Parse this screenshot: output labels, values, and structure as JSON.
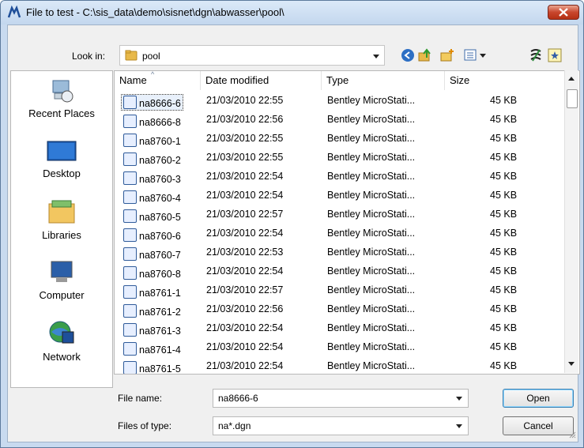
{
  "title": "File to test - C:\\sis_data\\demo\\sisnet\\dgn\\abwasser\\pool\\",
  "look_in": {
    "label": "Look in:",
    "value": "pool"
  },
  "toolbar_icons": [
    "back-icon",
    "up-folder-icon",
    "new-folder-icon",
    "view-menu-icon",
    "app-icon",
    "favorite-icon"
  ],
  "places": [
    {
      "label": "Recent Places",
      "icon": "recent-places-icon"
    },
    {
      "label": "Desktop",
      "icon": "desktop-icon"
    },
    {
      "label": "Libraries",
      "icon": "libraries-icon"
    },
    {
      "label": "Computer",
      "icon": "computer-icon"
    },
    {
      "label": "Network",
      "icon": "network-icon"
    }
  ],
  "columns": [
    "Name",
    "Date modified",
    "Type",
    "Size"
  ],
  "files": [
    {
      "name": "na8666-6",
      "date": "21/03/2010 22:55",
      "type": "Bentley MicroStati...",
      "size": "45 KB"
    },
    {
      "name": "na8666-8",
      "date": "21/03/2010 22:56",
      "type": "Bentley MicroStati...",
      "size": "45 KB"
    },
    {
      "name": "na8760-1",
      "date": "21/03/2010 22:55",
      "type": "Bentley MicroStati...",
      "size": "45 KB"
    },
    {
      "name": "na8760-2",
      "date": "21/03/2010 22:55",
      "type": "Bentley MicroStati...",
      "size": "45 KB"
    },
    {
      "name": "na8760-3",
      "date": "21/03/2010 22:54",
      "type": "Bentley MicroStati...",
      "size": "45 KB"
    },
    {
      "name": "na8760-4",
      "date": "21/03/2010 22:54",
      "type": "Bentley MicroStati...",
      "size": "45 KB"
    },
    {
      "name": "na8760-5",
      "date": "21/03/2010 22:57",
      "type": "Bentley MicroStati...",
      "size": "45 KB"
    },
    {
      "name": "na8760-6",
      "date": "21/03/2010 22:54",
      "type": "Bentley MicroStati...",
      "size": "45 KB"
    },
    {
      "name": "na8760-7",
      "date": "21/03/2010 22:53",
      "type": "Bentley MicroStati...",
      "size": "45 KB"
    },
    {
      "name": "na8760-8",
      "date": "21/03/2010 22:54",
      "type": "Bentley MicroStati...",
      "size": "45 KB"
    },
    {
      "name": "na8761-1",
      "date": "21/03/2010 22:57",
      "type": "Bentley MicroStati...",
      "size": "45 KB"
    },
    {
      "name": "na8761-2",
      "date": "21/03/2010 22:56",
      "type": "Bentley MicroStati...",
      "size": "45 KB"
    },
    {
      "name": "na8761-3",
      "date": "21/03/2010 22:54",
      "type": "Bentley MicroStati...",
      "size": "45 KB"
    },
    {
      "name": "na8761-4",
      "date": "21/03/2010 22:54",
      "type": "Bentley MicroStati...",
      "size": "45 KB"
    },
    {
      "name": "na8761-5",
      "date": "21/03/2010 22:54",
      "type": "Bentley MicroStati...",
      "size": "45 KB"
    }
  ],
  "selected_file": "na8666-6",
  "file_name": {
    "label": "File name:",
    "value": "na8666-6"
  },
  "file_type": {
    "label": "Files of type:",
    "value": "na*.dgn"
  },
  "buttons": {
    "open": "Open",
    "cancel": "Cancel"
  },
  "colors": {
    "title_bg": "#c8daef",
    "close": "#c8462d",
    "selection": "#e8f0fb"
  }
}
